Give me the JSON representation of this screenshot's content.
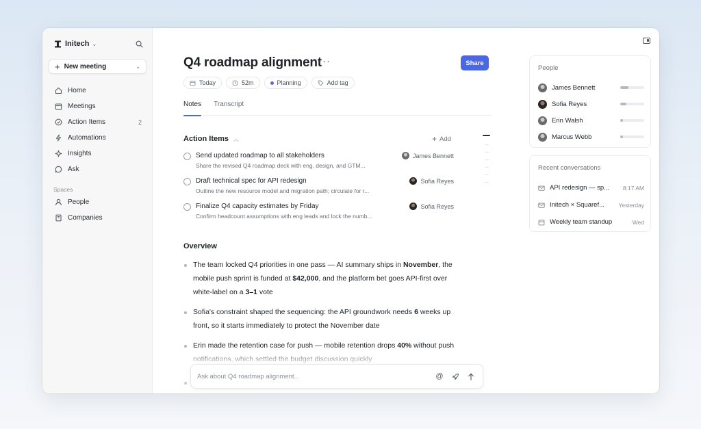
{
  "workspace": {
    "name": "Initech"
  },
  "sidebar": {
    "new_meeting_label": "New meeting",
    "nav": [
      {
        "label": "Home",
        "icon": "home-icon"
      },
      {
        "label": "Meetings",
        "icon": "calendar-icon"
      },
      {
        "label": "Action Items",
        "icon": "check-circle-icon",
        "count": "2"
      },
      {
        "label": "Automations",
        "icon": "lightning-icon"
      },
      {
        "label": "Insights",
        "icon": "sparkle-icon"
      },
      {
        "label": "Ask",
        "icon": "chat-bubble-icon"
      }
    ],
    "spaces_label": "Spaces",
    "spaces": [
      {
        "label": "People",
        "icon": "person-icon"
      },
      {
        "label": "Companies",
        "icon": "building-icon"
      }
    ]
  },
  "meeting": {
    "title": "Q4 roadmap alignment",
    "more": "···",
    "share_label": "Share",
    "chips": {
      "date": "Today",
      "duration": "52m",
      "tag": "Planning",
      "add_tag": "Add tag"
    },
    "tabs": [
      "Notes",
      "Transcript"
    ]
  },
  "action_items": {
    "title": "Action Items",
    "add_label": "Add",
    "items": [
      {
        "title": "Send updated roadmap to all stakeholders",
        "desc": "Share the revised Q4 roadmap deck with eng, design, and GTM...",
        "assignee": "James Bennett"
      },
      {
        "title": "Draft technical spec for API redesign",
        "desc": "Outline the new resource model and migration path; circulate for r...",
        "assignee": "Sofia Reyes"
      },
      {
        "title": "Finalize Q4 capacity estimates by Friday",
        "desc": "Confirm headcount assumptions with eng leads and lock the numb...",
        "assignee": "Sofia Reyes"
      }
    ]
  },
  "overview": {
    "title": "Overview",
    "bullets": [
      [
        "The team locked Q4 priorities in one pass — AI summary ships in ",
        "November",
        ", the mobile push sprint is funded at ",
        "$42,000",
        ", and the platform bet goes API-first over white-label on a ",
        "3–1",
        " vote"
      ],
      [
        "Sofia's constraint shaped the sequencing: the API groundwork needs ",
        "6",
        " weeks up front, so it starts immediately to protect the November date"
      ],
      [
        "Erin made the retention case for push — mobile retention drops ",
        "40%",
        " without push notifications, which settled the budget discussion quickly"
      ]
    ]
  },
  "ask": {
    "placeholder": "Ask about Q4 roadmap alignment..."
  },
  "people_card": {
    "title": "People",
    "people": [
      {
        "name": "James Bennett",
        "talk_share": 0.35
      },
      {
        "name": "Sofia Reyes",
        "talk_share": 0.25
      },
      {
        "name": "Erin Walsh",
        "talk_share": 0.12
      },
      {
        "name": "Marcus Webb",
        "talk_share": 0.1
      }
    ]
  },
  "conversations_card": {
    "title": "Recent conversations",
    "items": [
      {
        "name": "API redesign — sp...",
        "time": "8:17 AM",
        "icon": "mail-icon"
      },
      {
        "name": "Initech × Squaref...",
        "time": "Yesterday",
        "icon": "mail-icon"
      },
      {
        "name": "Weekly team standup",
        "time": "Wed",
        "icon": "calendar-icon"
      }
    ]
  },
  "colors": {
    "accent": "#4a67e6",
    "planning_dot": "#5a6ad8"
  }
}
